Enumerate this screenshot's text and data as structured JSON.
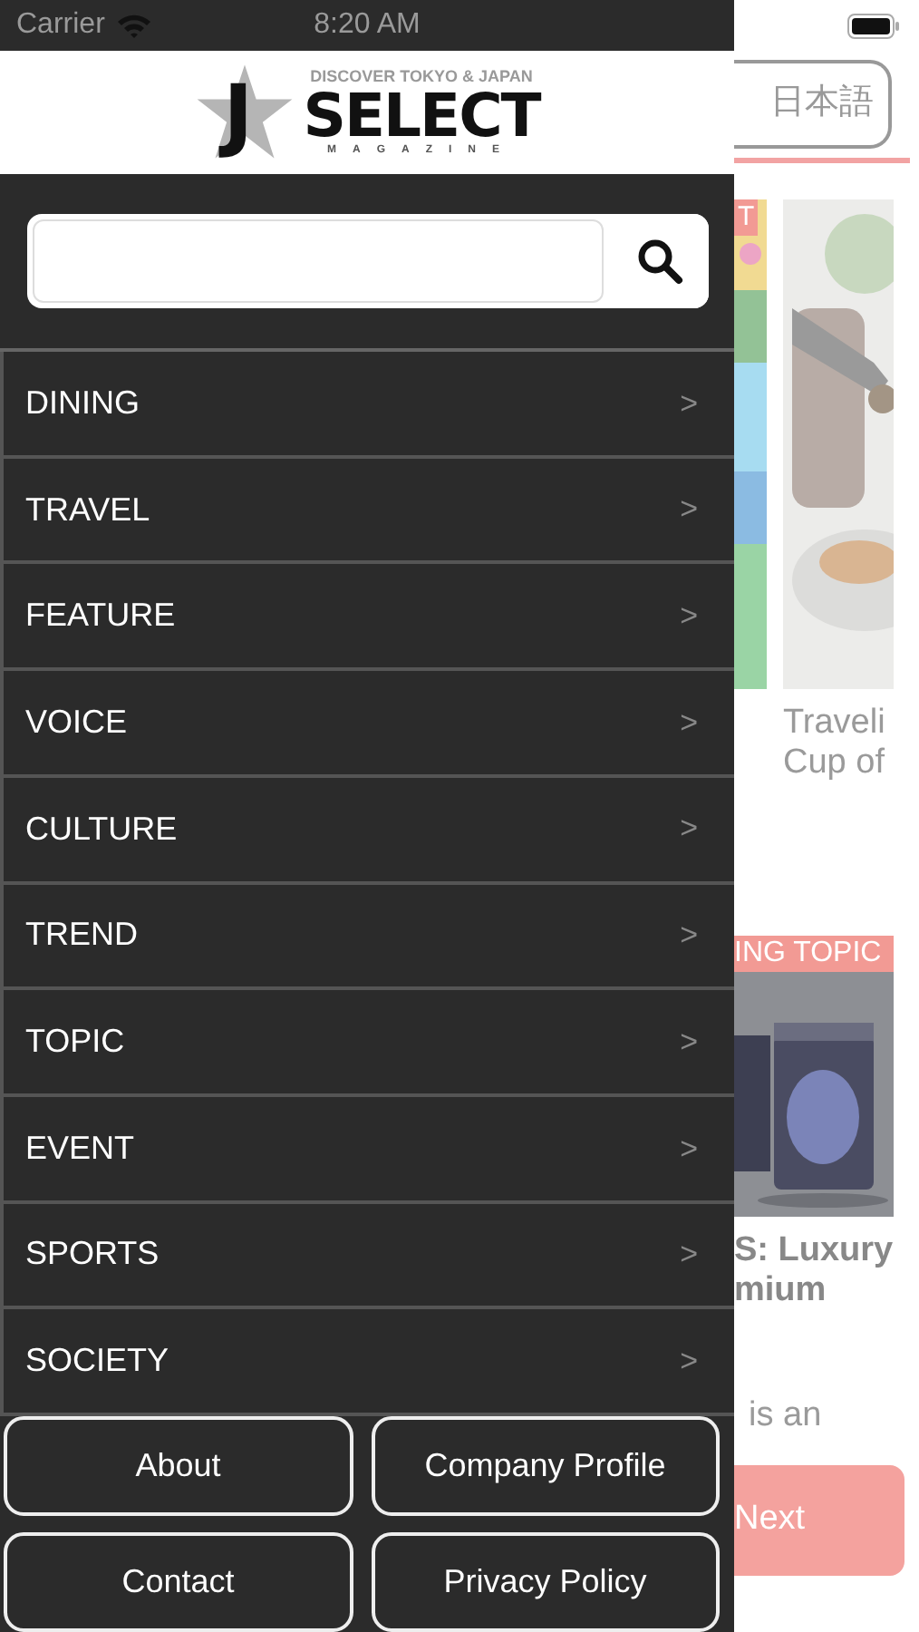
{
  "status_bar": {
    "carrier": "Carrier",
    "time": "8:20 AM"
  },
  "logo": {
    "initial": "J",
    "tagline": "DISCOVER TOKYO & JAPAN",
    "name": "SELECT",
    "subtitle": "MAGAZINE"
  },
  "menu": [
    {
      "label": "DINING",
      "chevron": ">"
    },
    {
      "label": "TRAVEL",
      "chevron": ">"
    },
    {
      "label": "FEATURE",
      "chevron": ">"
    },
    {
      "label": "VOICE",
      "chevron": ">"
    },
    {
      "label": "CULTURE",
      "chevron": ">"
    },
    {
      "label": "TREND",
      "chevron": ">"
    },
    {
      "label": "TOPIC",
      "chevron": ">"
    },
    {
      "label": "EVENT",
      "chevron": ">"
    },
    {
      "label": "SPORTS",
      "chevron": ">"
    },
    {
      "label": "SOCIETY",
      "chevron": ">"
    }
  ],
  "footer_links": [
    "About",
    "Company Profile",
    "Contact",
    "Privacy Policy"
  ],
  "background": {
    "language_button": "日本語",
    "articles": [
      {
        "tag": "T"
      },
      {
        "title": [
          "Traveli",
          "Cup of"
        ]
      }
    ],
    "feature": {
      "tag": "ING TOPIC",
      "title": [
        "S: Luxury",
        "mium"
      ],
      "excerpt": "is an"
    },
    "next_button": "Next"
  }
}
